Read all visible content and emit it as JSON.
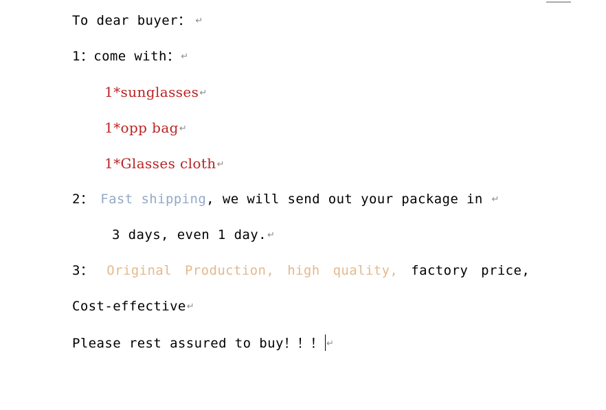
{
  "document": {
    "background_color": "#ffffff",
    "text_color": "#000000",
    "accents": {
      "red": "#bb2222",
      "blue": "#93a9c6",
      "orange": "#e3b98e",
      "return_mark": "#8c8c8c",
      "top_rule": "#a8a8a8"
    },
    "return_mark_glyph": "↵",
    "lines": {
      "greeting": {
        "text": "To dear buyer："
      },
      "item1_heading": {
        "text": "1：come with："
      },
      "bullet1": {
        "text": "1*sunglasses"
      },
      "bullet2": {
        "text": "1*opp bag"
      },
      "bullet3": {
        "text": "1*Glasses cloth"
      },
      "item2": {
        "number": "2：",
        "highlight": "Fast shipping",
        "rest": ", we will send out your package in "
      },
      "item2_cont": {
        "text": "3 days, even 1 day."
      },
      "item3": {
        "number": "3：",
        "word1": "Original",
        "word2": "Production,",
        "word3": "high",
        "word4": "quality,",
        "word5": "factory",
        "word6": "price,"
      },
      "item3_cont": {
        "text": "Cost-effective"
      },
      "closing": {
        "text": "Please rest assured to buy！！！"
      }
    }
  }
}
